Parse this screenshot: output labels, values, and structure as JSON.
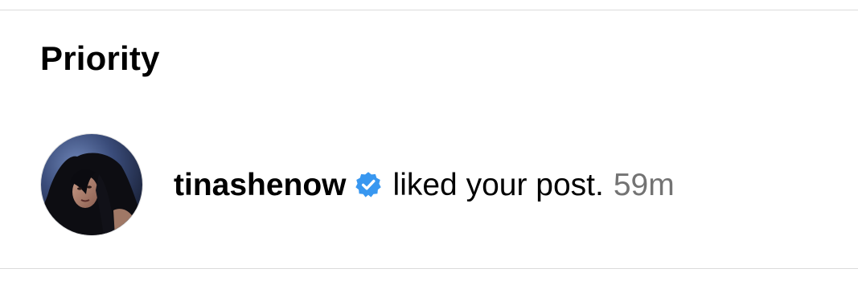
{
  "section": {
    "title": "Priority"
  },
  "notification": {
    "username": "tinashenow",
    "verified": true,
    "action": "liked your post.",
    "time": "59m",
    "badge_color": "#3897f0",
    "avatar_icon": "profile-photo"
  }
}
